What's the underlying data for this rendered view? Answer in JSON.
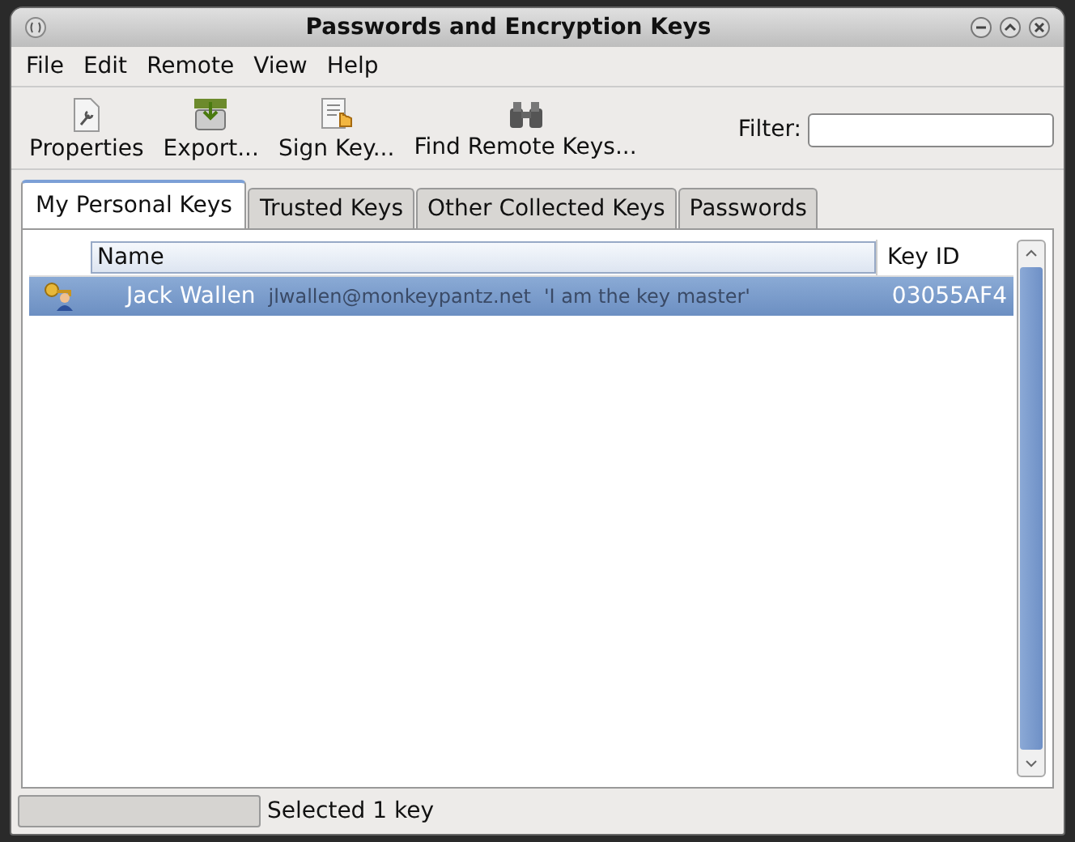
{
  "window": {
    "title": "Passwords and Encryption Keys"
  },
  "menu": [
    "File",
    "Edit",
    "Remote",
    "View",
    "Help"
  ],
  "toolbar": [
    {
      "kind": "properties",
      "label": "Properties"
    },
    {
      "kind": "export",
      "label": "Export..."
    },
    {
      "kind": "sign",
      "label": "Sign Key..."
    },
    {
      "kind": "find",
      "label": "Find Remote Keys..."
    }
  ],
  "filter": {
    "label": "Filter:"
  },
  "tabs": [
    {
      "label": "My Personal Keys",
      "selected": true
    },
    {
      "label": "Trusted Keys",
      "selected": false
    },
    {
      "label": "Other Collected Keys",
      "selected": false
    },
    {
      "label": "Passwords",
      "selected": false
    }
  ],
  "table": {
    "columns": [
      "Name",
      "Key ID"
    ],
    "rows": [
      {
        "name": "Jack Wallen",
        "email": "jlwallen@monkeypantz.net",
        "comment": "'I am the key master'",
        "key_id": "03055AF4",
        "selected": true
      }
    ]
  },
  "status_bar": {
    "text": "Selected 1 key"
  }
}
